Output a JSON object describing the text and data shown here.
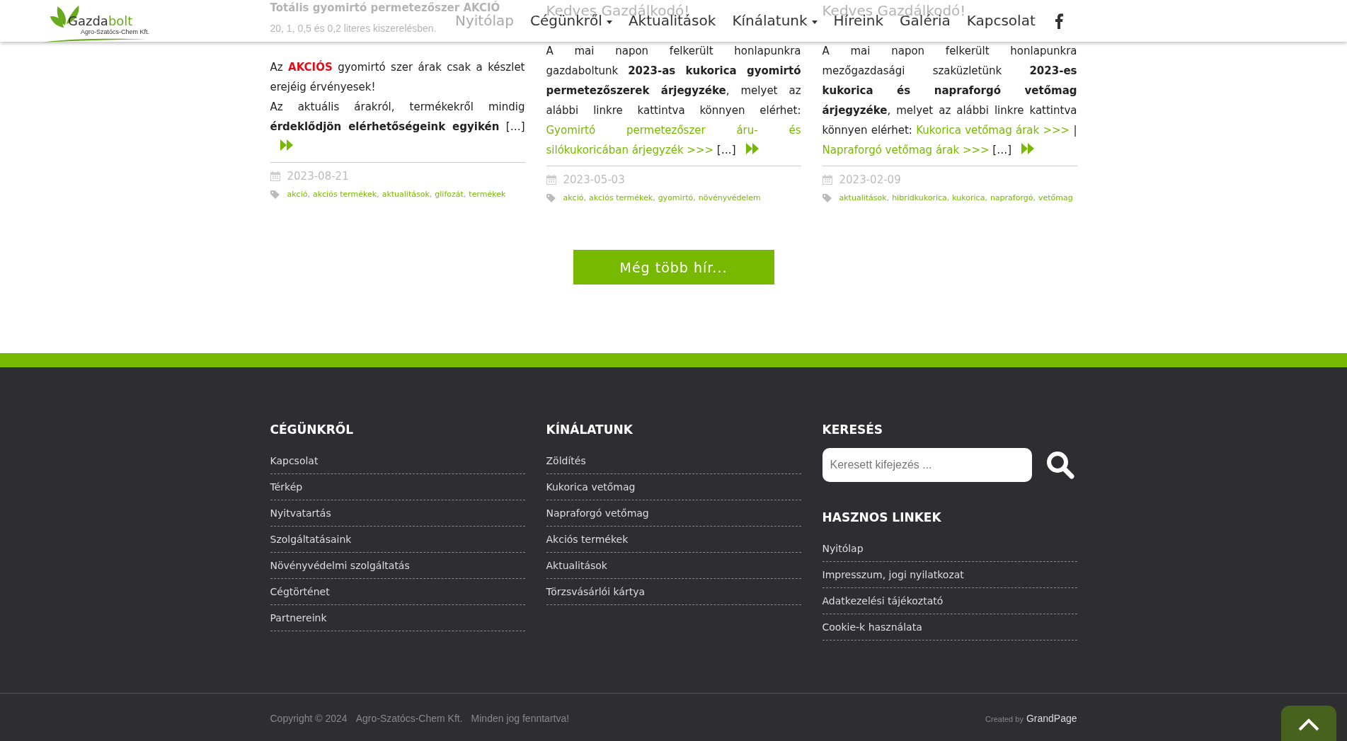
{
  "header": {
    "logo": {
      "word_1": "Gazda",
      "word_2": "bolt",
      "tagline": "Agro-Szatócs-Chem Kft."
    },
    "nav": [
      {
        "label": "Nyitólap",
        "selected": true,
        "dropdown": false
      },
      {
        "label": "Cégünkről",
        "selected": false,
        "dropdown": true
      },
      {
        "label": "Aktualitások",
        "selected": false,
        "dropdown": false
      },
      {
        "label": "Kínálatunk",
        "selected": false,
        "dropdown": true
      },
      {
        "label": "Híreink",
        "selected": false,
        "dropdown": false
      },
      {
        "label": "Galéria",
        "selected": false,
        "dropdown": false
      },
      {
        "label": "Kapcsolat",
        "selected": false,
        "dropdown": false
      }
    ]
  },
  "articles": [
    {
      "lead": [
        {
          "kind": "bold",
          "text": "Totális gyomirtó permetezőszer AKCIÓ"
        },
        {
          "kind": "plain",
          "text": "20, 1, 0,5  és 0,2 literes kiszerelésben."
        }
      ],
      "paragraphs": [
        [
          {
            "kind": "plain",
            "text": "Az "
          },
          {
            "kind": "red",
            "text": "AKCIÓS"
          },
          {
            "kind": "plain",
            "text": " gyomirtó szer árak csak a készlet erejéig érvényesek!"
          }
        ],
        [
          {
            "kind": "plain",
            "text": "Az aktuális árakról, termékekről mindig "
          },
          {
            "kind": "bold",
            "text": "érdeklődjön elérhetőségeink egyikén"
          },
          {
            "kind": "plain",
            "text": " […]"
          }
        ]
      ],
      "date": "2023-08-21",
      "tags": [
        "akció",
        "akciós termékek",
        "aktualitások",
        "glifozát",
        "termékek"
      ]
    },
    {
      "lead": [
        {
          "kind": "heading",
          "text": "Kedves Gazdálkodó!"
        }
      ],
      "paragraphs": [
        [
          {
            "kind": "plain",
            "text": "A mai napon felkerült honlapunkra gazdaboltunk "
          },
          {
            "kind": "bold",
            "text": "2023-as kukorica gyomirtó permetezőszerek árjegyzéke"
          },
          {
            "kind": "plain",
            "text": ", melyet az alábbi linkre kattintva könnyen elérhet: "
          },
          {
            "kind": "link",
            "text": "Gyomirtó permetezőszer áru- és"
          },
          {
            "kind": "link",
            "text": "silókukoricában árjegyzék >>>"
          },
          {
            "kind": "plain",
            "text": " […]"
          }
        ]
      ],
      "date": "2023-05-03",
      "tags": [
        "akció",
        "akciós termékek",
        "gyomirtó",
        "növényvédelem"
      ]
    },
    {
      "lead": [
        {
          "kind": "heading",
          "text": "Kedves Gazdálkodó!"
        }
      ],
      "paragraphs": [
        [
          {
            "kind": "plain",
            "text": "A mai napon felkerült honlapunkra mezőgazdasági szaküzletünk "
          },
          {
            "kind": "bold",
            "text": "2023-es kukorica és napraforgó vetőmag árjegyzéke"
          },
          {
            "kind": "plain",
            "text": ", melyet az alábbi linkre kattintva könnyen elérhet: "
          },
          {
            "kind": "link",
            "text": "Kukorica vetőmag árak >>>"
          },
          {
            "kind": "plain",
            "text": " | "
          },
          {
            "kind": "link",
            "text": "Napraforgó vetőmag árak >>>"
          },
          {
            "kind": "plain",
            "text": " […]"
          }
        ]
      ],
      "date": "2023-02-09",
      "tags": [
        "aktualitások",
        "hibridkukorica",
        "kukorica",
        "napraforgó",
        "vetőmag"
      ]
    }
  ],
  "tag_separator": ",",
  "more_button": "Még több hír...",
  "footer": {
    "columns": [
      {
        "title": "CÉGÜNKRŐL",
        "links": [
          "Kapcsolat",
          "Térkép",
          "Nyitvatartás",
          "Szolgáltatásaink",
          "Növényvédelmi szolgáltatás",
          "Cégtörténet",
          "Partnereink"
        ]
      },
      {
        "title": "KÍNÁLATUNK",
        "links": [
          "Zöldítés",
          "Kukorica vetőmag",
          "Napraforgó vetőmag",
          "Akciós termékek",
          "Aktualitások",
          "Törzsvásárlói kártya"
        ]
      }
    ],
    "search": {
      "title": "KERESÉS",
      "placeholder": "Keresett kifejezés ..."
    },
    "useful": {
      "title": "HASZNOS LINKEK",
      "links": [
        "Nyitólap",
        "Impresszum, jogi nyilatkozat",
        "Adatkezelési tájékoztató",
        "Cookie-k használata"
      ]
    }
  },
  "bottom": {
    "copyright": [
      "Copyright © 2024",
      "Agro-Szatócs-Chem Kft.",
      "Minden jog fenntartva!"
    ],
    "created_by": "Created by",
    "author": "GrandPage"
  }
}
